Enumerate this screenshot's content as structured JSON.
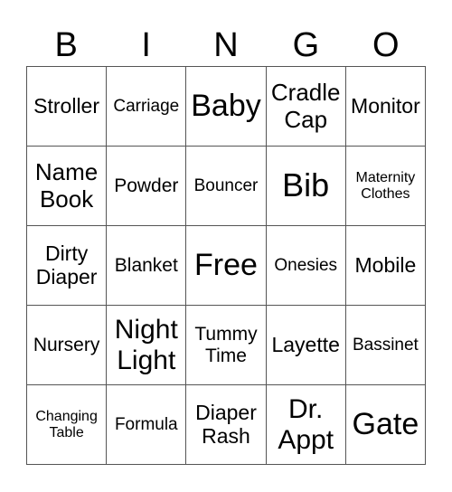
{
  "header": [
    "B",
    "I",
    "N",
    "G",
    "O"
  ],
  "cells": [
    [
      "Stroller",
      "Carriage",
      "Baby",
      "Cradle Cap",
      "Monitor"
    ],
    [
      "Name Book",
      "Powder",
      "Bouncer",
      "Bib",
      "Maternity Clothes"
    ],
    [
      "Dirty Diaper",
      "Blanket",
      "Free",
      "Onesies",
      "Mobile"
    ],
    [
      "Nursery",
      "Night Light",
      "Tummy Time",
      "Layette",
      "Bassinet"
    ],
    [
      "Changing Table",
      "Formula",
      "Diaper Rash",
      "Dr. Appt",
      "Gate"
    ]
  ]
}
